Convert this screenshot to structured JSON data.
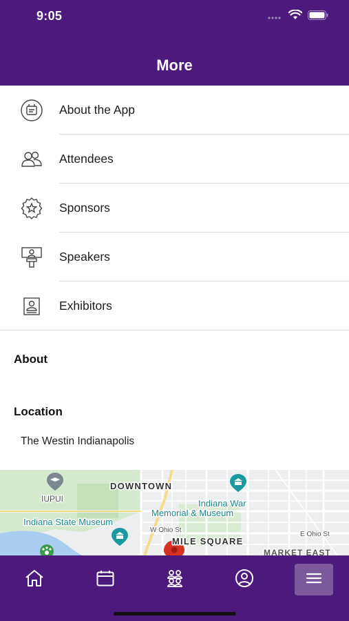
{
  "status_bar": {
    "time": "9:05"
  },
  "header": {
    "title": "More"
  },
  "menu": {
    "items": [
      {
        "label": "About the App",
        "icon": "info-badge-icon"
      },
      {
        "label": "Attendees",
        "icon": "people-icon"
      },
      {
        "label": "Sponsors",
        "icon": "star-badge-icon"
      },
      {
        "label": "Speakers",
        "icon": "podium-icon"
      },
      {
        "label": "Exhibitors",
        "icon": "booth-icon"
      }
    ]
  },
  "about": {
    "heading": "About"
  },
  "location": {
    "heading": "Location",
    "name": "The Westin Indianapolis",
    "map": {
      "labels": {
        "downtown": "DOWNTOWN",
        "iupui": "IUPUI",
        "museum": "Indiana State Museum",
        "war_memorial_1": "Indiana War",
        "war_memorial_2": "Memorial & Museum",
        "ohio_w": "W Ohio St",
        "ohio_e": "E Ohio St",
        "mile_square": "MILE SQUARE",
        "market_east": "MARKET EAST"
      }
    }
  },
  "tabbar": {
    "tabs": [
      {
        "icon": "home-icon"
      },
      {
        "icon": "calendar-icon"
      },
      {
        "icon": "attendees-icon"
      },
      {
        "icon": "profile-icon"
      },
      {
        "icon": "menu-icon",
        "active": true
      }
    ]
  },
  "colors": {
    "brand": "#4b1a7c",
    "active_tab": "#7a5a9d",
    "map_green": "#cfe8c9",
    "map_water": "#9cc3e8",
    "map_label_teal": "#1a8c8a",
    "pin": "#d93025"
  }
}
